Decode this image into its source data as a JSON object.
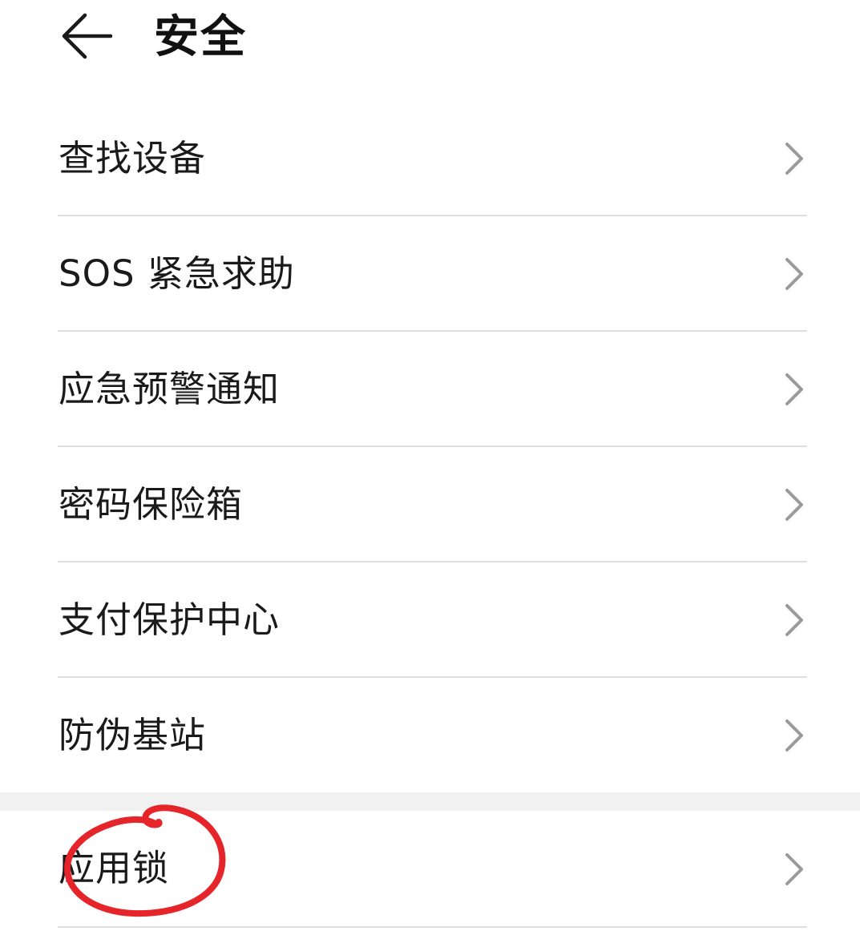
{
  "header": {
    "title": "安全",
    "back_icon": "arrow-left-icon"
  },
  "menu": {
    "items": [
      {
        "label": "查找设备"
      },
      {
        "label": "SOS 紧急求助"
      },
      {
        "label": "应急预警通知"
      },
      {
        "label": "密码保险箱"
      },
      {
        "label": "支付保护中心"
      },
      {
        "label": "防伪基站"
      }
    ],
    "bottom_items": [
      {
        "label": "应用锁"
      }
    ],
    "chevron_icon": "chevron-right-icon"
  },
  "colors": {
    "text": "#1a1a1a",
    "chevron": "#9a9a9a",
    "divider": "#dedede",
    "section_gap": "#f1f1f1",
    "annotation": "#e5252a"
  },
  "annotation": {
    "type": "hand-drawn-circle",
    "target": "应用锁"
  }
}
